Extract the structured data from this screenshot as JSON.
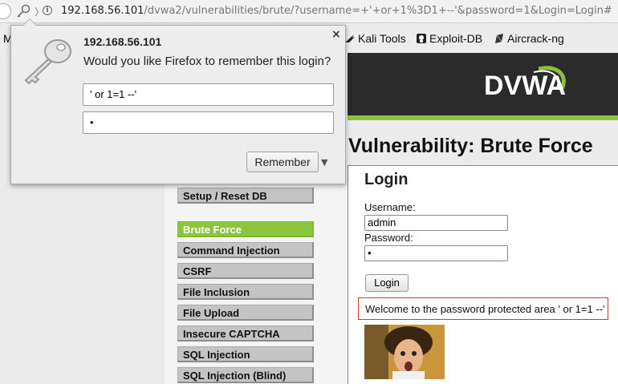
{
  "browser": {
    "url_host": "192.168.56.101",
    "url_path": "/dvwa2/vulnerabilities/brute/?username=+'+or+1%3D1+--'&password=1&Login=Login#"
  },
  "bookmarks": {
    "truncated_first": "M",
    "items": [
      {
        "label": "Kali Tools",
        "icon": "kali-dragon-icon"
      },
      {
        "label": "Exploit-DB",
        "icon": "exploit-db-icon"
      },
      {
        "label": "Aircrack-ng",
        "icon": "aircrack-icon"
      }
    ]
  },
  "popup": {
    "host": "192.168.56.101",
    "question": "Would you like Firefox to remember this login?",
    "username_value": "' or 1=1 --'",
    "password_value": "•",
    "remember_label": "Remember",
    "close_glyph": "×",
    "dropdown_glyph": "▼"
  },
  "dvwa": {
    "logo_text": "DVWA",
    "page_title": "Vulnerability: Brute Force",
    "login_heading": "Login",
    "username_label": "Username:",
    "username_value": "admin",
    "password_label": "Password:",
    "password_value": "•",
    "login_button": "Login",
    "welcome_message": "Welcome to the password protected area ' or 1=1 --'"
  },
  "menu": {
    "setup": "Setup / Reset DB",
    "items": [
      {
        "label": "Brute Force",
        "active": true
      },
      {
        "label": "Command Injection",
        "active": false
      },
      {
        "label": "CSRF",
        "active": false
      },
      {
        "label": "File Inclusion",
        "active": false
      },
      {
        "label": "File Upload",
        "active": false
      },
      {
        "label": "Insecure CAPTCHA",
        "active": false
      },
      {
        "label": "SQL Injection",
        "active": false
      },
      {
        "label": "SQL Injection (Blind)",
        "active": false
      }
    ]
  },
  "colors": {
    "menu_active": "#8cc63f",
    "header_bg": "#2b2b2b",
    "welcome_border": "#dd3333"
  }
}
